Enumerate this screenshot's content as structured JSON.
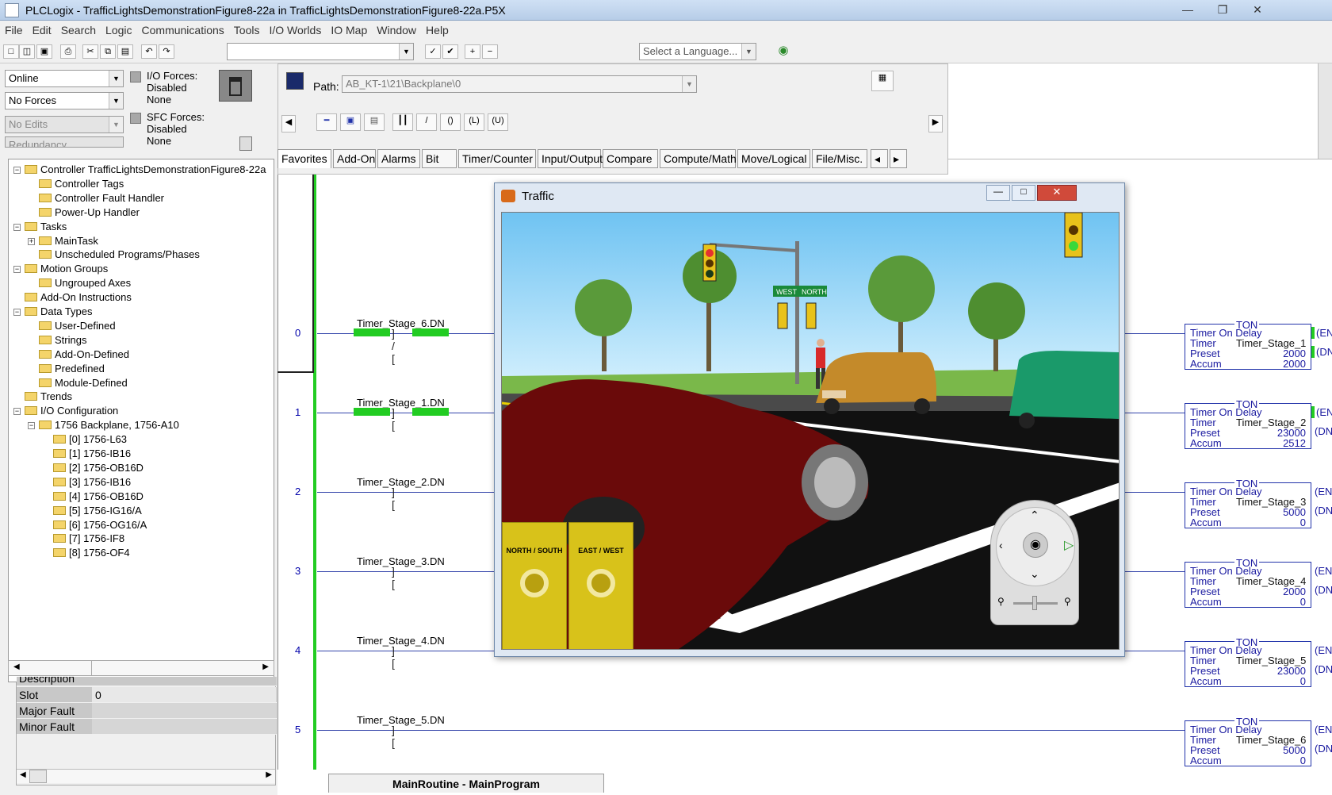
{
  "window": {
    "title": "PLCLogix  -  TrafficLightsDemonstrationFigure8-22a in TrafficLightsDemonstrationFigure8-22a.P5X"
  },
  "menu": [
    "File",
    "Edit",
    "Search",
    "Logic",
    "Communications",
    "Tools",
    "I/O Worlds",
    "IO Map",
    "Window",
    "Help"
  ],
  "toolbar": {
    "language_placeholder": "Select a Language..."
  },
  "status": {
    "mode": "Online",
    "forces": "No Forces",
    "edits": "No Edits",
    "redundancy": "Redundancy",
    "io_forces_label": "I/O Forces:",
    "io_forces_state": "Disabled",
    "io_forces_value": "None",
    "sfc_forces_label": "SFC Forces:",
    "sfc_forces_state": "Disabled",
    "sfc_forces_value": "None"
  },
  "path": {
    "label": "Path:",
    "value": "AB_KT-1\\21\\Backplane\\0"
  },
  "palette_tabs": [
    "Favorites",
    "Add-On",
    "Alarms",
    "Bit",
    "Timer/Counter",
    "Input/Output",
    "Compare",
    "Compute/Math",
    "Move/Logical",
    "File/Misc."
  ],
  "tree": [
    {
      "label": "Controller TrafficLightsDemonstrationFigure8-22a",
      "level": 0,
      "pm": "-"
    },
    {
      "label": "Controller Tags",
      "level": 1
    },
    {
      "label": "Controller Fault Handler",
      "level": 1
    },
    {
      "label": "Power-Up Handler",
      "level": 1
    },
    {
      "label": "Tasks",
      "level": 0,
      "pm": "-"
    },
    {
      "label": "MainTask",
      "level": 1,
      "pm": "+"
    },
    {
      "label": "Unscheduled Programs/Phases",
      "level": 1
    },
    {
      "label": "Motion Groups",
      "level": 0,
      "pm": "-"
    },
    {
      "label": "Ungrouped Axes",
      "level": 1
    },
    {
      "label": "Add-On Instructions",
      "level": 0
    },
    {
      "label": "Data Types",
      "level": 0,
      "pm": "-"
    },
    {
      "label": "User-Defined",
      "level": 1
    },
    {
      "label": "Strings",
      "level": 1
    },
    {
      "label": "Add-On-Defined",
      "level": 1
    },
    {
      "label": "Predefined",
      "level": 1
    },
    {
      "label": "Module-Defined",
      "level": 1
    },
    {
      "label": "Trends",
      "level": 0
    },
    {
      "label": "I/O Configuration",
      "level": 0,
      "pm": "-"
    },
    {
      "label": "1756 Backplane, 1756-A10",
      "level": 1,
      "pm": "-"
    },
    {
      "label": "[0] 1756-L63",
      "level": 2
    },
    {
      "label": "[1] 1756-IB16",
      "level": 2
    },
    {
      "label": "[2] 1756-OB16D",
      "level": 2
    },
    {
      "label": "[3] 1756-IB16",
      "level": 2
    },
    {
      "label": "[4] 1756-OB16D",
      "level": 2
    },
    {
      "label": "[5] 1756-IG16/A",
      "level": 2
    },
    {
      "label": "[6] 1756-OG16/A",
      "level": 2
    },
    {
      "label": "[7] 1756-IF8",
      "level": 2
    },
    {
      "label": "[8] 1756-OF4",
      "level": 2
    }
  ],
  "properties": {
    "description": "Description",
    "slot_label": "Slot",
    "slot_value": "0",
    "major_label": "Major Fault",
    "minor_label": "Minor Fault"
  },
  "rungs": [
    {
      "num": "0",
      "tag": "Timer_Stage_6.DN",
      "timer": "Timer_Stage_1",
      "preset": "2000",
      "accum": "2000",
      "active": true
    },
    {
      "num": "1",
      "tag": "Timer_Stage_1.DN",
      "timer": "Timer_Stage_2",
      "preset": "23000",
      "accum": "2512",
      "active": true
    },
    {
      "num": "2",
      "tag": "Timer_Stage_2.DN",
      "timer": "Timer_Stage_3",
      "preset": "5000",
      "accum": "0",
      "active": false
    },
    {
      "num": "3",
      "tag": "Timer_Stage_3.DN",
      "timer": "Timer_Stage_4",
      "preset": "2000",
      "accum": "0",
      "active": false
    },
    {
      "num": "4",
      "tag": "Timer_Stage_4.DN",
      "timer": "Timer_Stage_5",
      "preset": "23000",
      "accum": "0",
      "active": false
    },
    {
      "num": "5",
      "tag": "Timer_Stage_5.DN",
      "timer": "Timer_Stage_6",
      "preset": "5000",
      "accum": "0",
      "active": false
    }
  ],
  "ton": {
    "head": "TON",
    "name": "Timer On Delay",
    "timer_label": "Timer",
    "preset_label": "Preset",
    "accum_label": "Accum",
    "en": "(EN",
    "dn": "(DN"
  },
  "traffic": {
    "title": "Traffic",
    "ns_label": "NORTH / SOUTH",
    "ew_label": "EAST / WEST",
    "sign1": "WEST",
    "sign2": "NORTH"
  },
  "routine_tab": "MainRoutine - MainProgram"
}
